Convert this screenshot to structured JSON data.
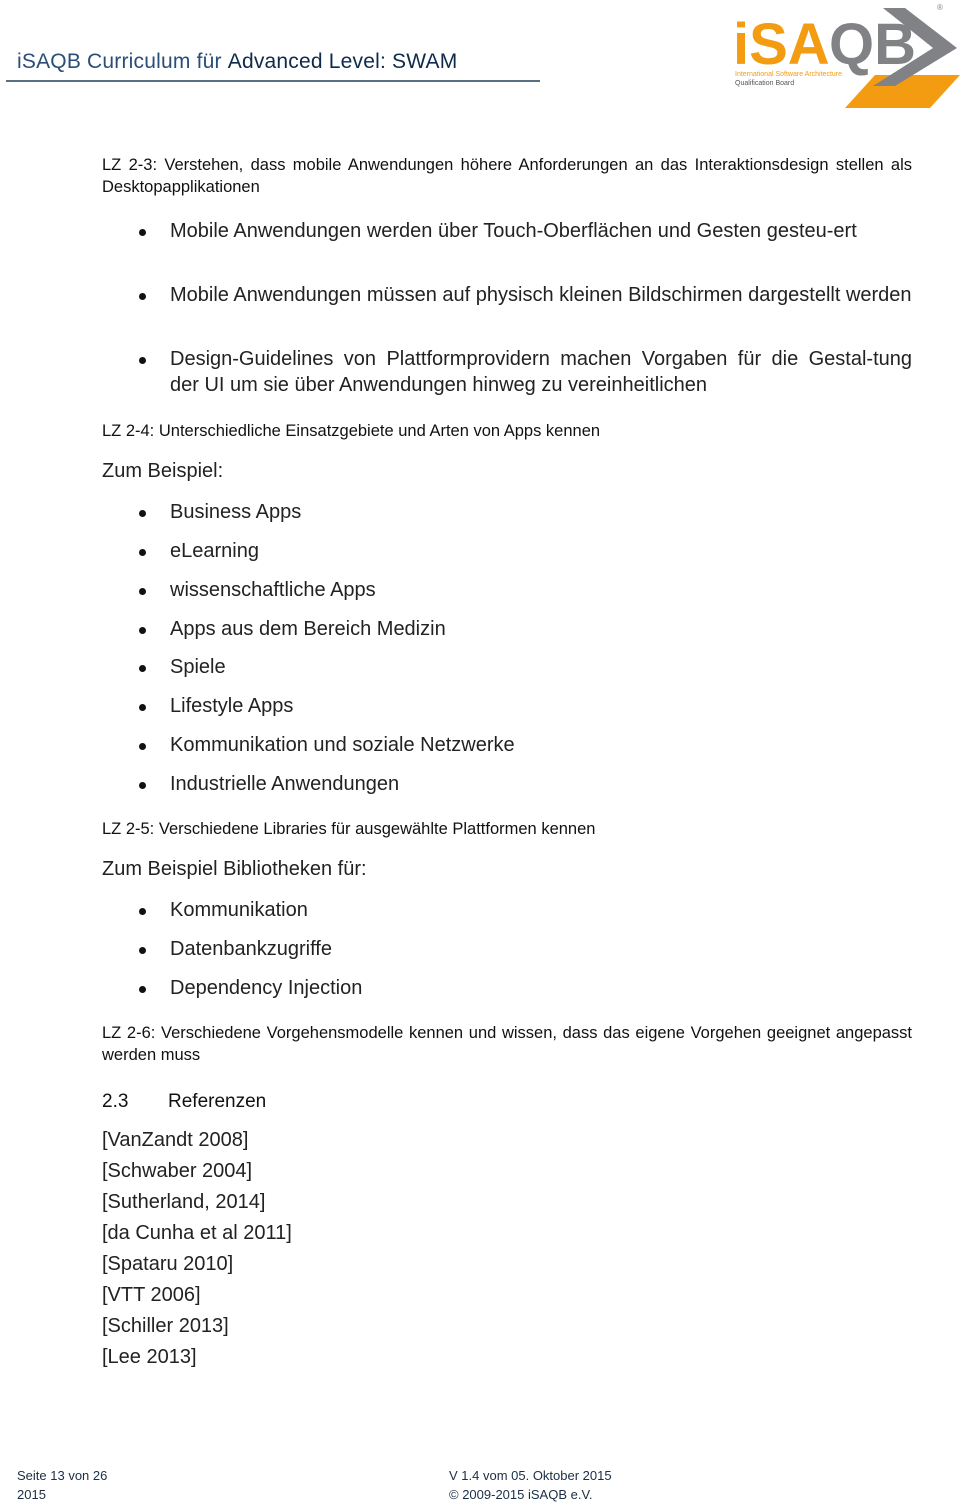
{
  "header": {
    "title_light": "iSAQB Curriculum für ",
    "title_strong": "Advanced Level: SWAM",
    "logo": {
      "name": "iSAQB",
      "tagline_line1": "International Software Architecture",
      "tagline_line2": "Qualification Board",
      "brand_orange": "#f39c12",
      "brand_gray": "#808285"
    }
  },
  "content": {
    "lz23": {
      "title": "LZ 2-3: Verstehen, dass mobile Anwendungen höhere Anforderungen an das Interaktionsdesign stellen als Desktopapplikationen",
      "bullets": [
        "Mobile Anwendungen werden über Touch-Oberflächen und Gesten gesteu-ert",
        "Mobile Anwendungen müssen auf physisch kleinen Bildschirmen dargestellt werden",
        "Design-Guidelines von Plattformprovidern machen Vorgaben für die Gestal-tung der UI um sie über Anwendungen hinweg zu vereinheitlichen"
      ]
    },
    "lz24": {
      "title": "LZ 2-4: Unterschiedliche Einsatzgebiete und Arten von Apps kennen",
      "intro": "Zum Beispiel:",
      "bullets": [
        "Business Apps",
        "eLearning",
        "wissenschaftliche Apps",
        "Apps aus dem Bereich Medizin",
        "Spiele",
        "Lifestyle Apps",
        "Kommunikation und soziale Netzwerke",
        "Industrielle Anwendungen"
      ]
    },
    "lz25": {
      "title": "LZ 2-5: Verschiedene Libraries für ausgewählte Plattformen kennen",
      "intro": "Zum Beispiel Bibliotheken für:",
      "bullets": [
        "Kommunikation",
        "Datenbankzugriffe",
        "Dependency Injection"
      ]
    },
    "lz26": {
      "title": "LZ 2-6: Verschiedene Vorgehensmodelle kennen und wissen, dass das eigene Vorgehen geeignet angepasst werden muss"
    },
    "section": {
      "number": "2.3",
      "title": "Referenzen"
    },
    "references": [
      "[VanZandt 2008]",
      "[Schwaber 2004]",
      "[Sutherland, 2014]",
      "[da Cunha et al 2011]",
      "[Spataru 2010]",
      "[VTT 2006]",
      "[Schiller 2013]",
      "[Lee 2013]"
    ]
  },
  "footer": {
    "page": "Seite 13 von 26",
    "year": "2015",
    "version": "V 1.4 vom 05. Oktober 2015",
    "copyright": "© 2009-2015 iSAQB e.V."
  }
}
